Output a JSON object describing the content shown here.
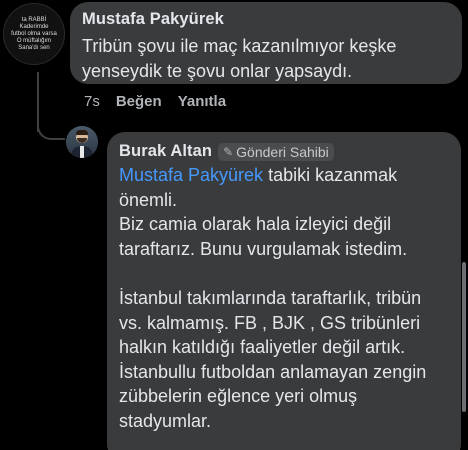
{
  "comment": {
    "author": "Mustafa Pakyürek",
    "avatar_text": [
      "ta RABBİ",
      "Kaderimde",
      "futbol olma varsa",
      "O müftalığım",
      "Sana'dı sen"
    ],
    "text": "Tribün şovu  ile maç kazanılmıyor keşke yenseydik te şovu onlar yapsaydı.",
    "time": "7s",
    "like_label": "Beğen",
    "reply_label": "Yanıtla"
  },
  "reply": {
    "author": "Burak Altan",
    "badge_label": "Gönderi Sahibi",
    "mention": "Mustafa Pakyürek",
    "lines": [
      " tabiki kazanmak önemli.",
      "Biz camia olarak hala izleyici değil taraftarız. Bunu vurgulamak istedim.",
      "İstanbul takımlarında taraftarlık, tribün vs. kalmamış.  FB , BJK , GS tribünleri halkın katıldığı faaliyetler değil artık.",
      "İstanbullu futboldan anlamayan zengin zübbelerin eğlence yeri olmuş stadyumlar."
    ]
  },
  "colors": {
    "background": "#000000",
    "bubble": "#3a3b3c",
    "text": "#e4e6eb",
    "secondary": "#b0b3b8",
    "mention": "#4599ff"
  },
  "icons": {
    "badge": "pencil-icon"
  }
}
